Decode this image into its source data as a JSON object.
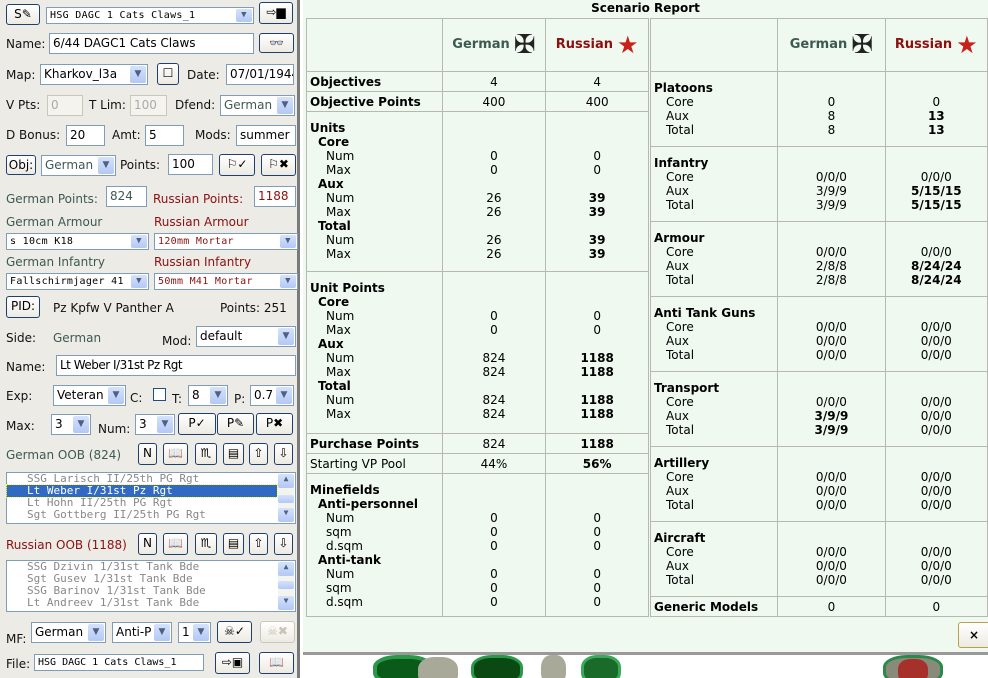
{
  "left": {
    "scenario_select": "HSG DAGC 1 Cats Claws_1",
    "name_label": "Name:",
    "name_value": "6/44 DAGC1 Cats Claws",
    "map_label": "Map:",
    "map_value": "Kharkov_l3a",
    "date_label": "Date:",
    "date_value": "07/01/1944",
    "vpts_label": "V Pts:",
    "vpts_value": "0",
    "tlim_label": "T Lim:",
    "tlim_value": "100",
    "dfend_label": "Dfend:",
    "dfend_value": "German",
    "dbonus_label": "D Bonus:",
    "dbonus_value": "20",
    "amt_label": "Amt:",
    "amt_value": "5",
    "mods_label": "Mods:",
    "mods_value": "summer",
    "obj_button": "Obj:",
    "obj_side": "German",
    "points_label": "Points:",
    "points_value": "100",
    "german_points_label": "German Points:",
    "german_points": "824",
    "russian_points_label": "Russian Points:",
    "russian_points": "1188",
    "german_armour_label": "German Armour",
    "german_armour": "s 10cm K18",
    "russian_armour_label": "Russian Armour",
    "russian_armour": "120mm Mortar",
    "german_infantry_label": "German Infantry",
    "german_infantry": "Fallschirmjager 41",
    "russian_infantry_label": "Russian Infantry",
    "russian_infantry": "50mm M41 Mortar",
    "pid_button": "PID:",
    "unit_type": "Pz Kpfw V Panther A",
    "unit_points": "Points: 251",
    "side_label": "Side:",
    "side_value": "German",
    "mod_label": "Mod:",
    "mod_value": "default",
    "unit_name_label": "Name:",
    "unit_name": "Lt Weber I/31st Pz Rgt",
    "exp_label": "Exp:",
    "exp_value": "Veteran",
    "c_label": "C:",
    "t_label": "T:",
    "t_value": "8",
    "p_label": "P:",
    "p_value": "0.7",
    "max_label": "Max:",
    "max_value": "3",
    "num_label": "Num:",
    "num_value": "3",
    "german_oob_label": "German OOB (824)",
    "russian_oob_label": "Russian OOB (1188)",
    "n_button": "N",
    "german_oob": [
      "SSG Larisch II/25th PG Rgt",
      "Lt Weber I/31st Pz Rgt",
      "Lt Hohn II/25th PG Rgt",
      "Sgt Gottberg II/25th PG Rgt"
    ],
    "german_oob_selected": 1,
    "russian_oob": [
      "SSG Dzivin 1/31st Tank Bde",
      "Sgt Gusev 1/31st Tank Bde",
      "SSG Barinov 1/31st Tank Bde",
      "Lt Andreev 1/31st Tank Bde"
    ],
    "mf_label": "MF:",
    "mf_side": "German",
    "mf_type": "Anti-P",
    "mf_count": "1",
    "file_label": "File:",
    "file_value": "HSG DAGC 1 Cats Claws_1"
  },
  "report": {
    "title": "Scenario Report",
    "german": "German",
    "russian": "Russian",
    "left_sections": [
      {
        "lines": [
          {
            "t": "Objectives",
            "lv": 0,
            "g": "4",
            "r": "4"
          }
        ]
      },
      {
        "lines": [
          {
            "t": "Objective Points",
            "lv": 0,
            "g": "400",
            "r": "400"
          }
        ]
      },
      {
        "lines": [
          {
            "t": "Units",
            "lv": 0,
            "g": "",
            "r": ""
          },
          {
            "t": "Core",
            "lv": 1,
            "g": "",
            "r": ""
          },
          {
            "t": "Num",
            "lv": 2,
            "g": "0",
            "r": "0"
          },
          {
            "t": "Max",
            "lv": 2,
            "g": "0",
            "r": "0"
          },
          {
            "t": "Aux",
            "lv": 1,
            "g": "",
            "r": ""
          },
          {
            "t": "Num",
            "lv": 2,
            "g": "26",
            "r": "39",
            "rb": true
          },
          {
            "t": "Max",
            "lv": 2,
            "g": "26",
            "r": "39",
            "rb": true
          },
          {
            "t": "Total",
            "lv": 1,
            "g": "",
            "r": ""
          },
          {
            "t": "Num",
            "lv": 2,
            "g": "26",
            "r": "39",
            "rb": true
          },
          {
            "t": "Max",
            "lv": 2,
            "g": "26",
            "r": "39",
            "rb": true
          }
        ]
      },
      {
        "lines": [
          {
            "t": "Unit Points",
            "lv": 0,
            "g": "",
            "r": ""
          },
          {
            "t": "Core",
            "lv": 1,
            "g": "",
            "r": ""
          },
          {
            "t": "Num",
            "lv": 2,
            "g": "0",
            "r": "0"
          },
          {
            "t": "Max",
            "lv": 2,
            "g": "0",
            "r": "0"
          },
          {
            "t": "Aux",
            "lv": 1,
            "g": "",
            "r": ""
          },
          {
            "t": "Num",
            "lv": 2,
            "g": "824",
            "r": "1188",
            "rb": true
          },
          {
            "t": "Max",
            "lv": 2,
            "g": "824",
            "r": "1188",
            "rb": true
          },
          {
            "t": "Total",
            "lv": 1,
            "g": "",
            "r": ""
          },
          {
            "t": "Num",
            "lv": 2,
            "g": "824",
            "r": "1188",
            "rb": true
          },
          {
            "t": "Max",
            "lv": 2,
            "g": "824",
            "r": "1188",
            "rb": true
          }
        ]
      },
      {
        "lines": [
          {
            "t": "Purchase Points",
            "lv": 0,
            "g": "824",
            "r": "1188",
            "rb": true
          }
        ]
      },
      {
        "lines": [
          {
            "t": "Starting VP Pool",
            "lv": 3,
            "g": "44%",
            "r": "56%",
            "rb": true
          }
        ]
      },
      {
        "lines": [
          {
            "t": "Minefields",
            "lv": 0,
            "g": "",
            "r": ""
          },
          {
            "t": "Anti-personnel",
            "lv": 1,
            "g": "",
            "r": ""
          },
          {
            "t": "Num",
            "lv": 2,
            "g": "0",
            "r": "0"
          },
          {
            "t": "sqm",
            "lv": 2,
            "g": "0",
            "r": "0"
          },
          {
            "t": "d.sqm",
            "lv": 2,
            "g": "0",
            "r": "0"
          },
          {
            "t": "Anti-tank",
            "lv": 1,
            "g": "",
            "r": ""
          },
          {
            "t": "Num",
            "lv": 2,
            "g": "0",
            "r": "0"
          },
          {
            "t": "sqm",
            "lv": 2,
            "g": "0",
            "r": "0"
          },
          {
            "t": "d.sqm",
            "lv": 2,
            "g": "0",
            "r": "0"
          }
        ]
      }
    ],
    "right_sections": [
      {
        "lines": [
          {
            "t": "Platoons",
            "lv": 0,
            "g": "",
            "r": ""
          },
          {
            "t": "Core",
            "lv": 2,
            "g": "0",
            "r": "0"
          },
          {
            "t": "Aux",
            "lv": 2,
            "g": "8",
            "r": "13",
            "rb": true
          },
          {
            "t": "Total",
            "lv": 2,
            "g": "8",
            "r": "13",
            "rb": true
          }
        ]
      },
      {
        "lines": [
          {
            "t": "Infantry",
            "lv": 0,
            "g": "",
            "r": ""
          },
          {
            "t": "Core",
            "lv": 2,
            "g": "0/0/0",
            "r": "0/0/0"
          },
          {
            "t": "Aux",
            "lv": 2,
            "g": "3/9/9",
            "r": "5/15/15",
            "rb": true
          },
          {
            "t": "Total",
            "lv": 2,
            "g": "3/9/9",
            "r": "5/15/15",
            "rb": true
          }
        ]
      },
      {
        "lines": [
          {
            "t": "Armour",
            "lv": 0,
            "g": "",
            "r": ""
          },
          {
            "t": "Core",
            "lv": 2,
            "g": "0/0/0",
            "r": "0/0/0"
          },
          {
            "t": "Aux",
            "lv": 2,
            "g": "2/8/8",
            "r": "8/24/24",
            "rb": true
          },
          {
            "t": "Total",
            "lv": 2,
            "g": "2/8/8",
            "r": "8/24/24",
            "rb": true
          }
        ]
      },
      {
        "lines": [
          {
            "t": "Anti Tank Guns",
            "lv": 0,
            "g": "",
            "r": ""
          },
          {
            "t": "Core",
            "lv": 2,
            "g": "0/0/0",
            "r": "0/0/0"
          },
          {
            "t": "Aux",
            "lv": 2,
            "g": "0/0/0",
            "r": "0/0/0"
          },
          {
            "t": "Total",
            "lv": 2,
            "g": "0/0/0",
            "r": "0/0/0"
          }
        ]
      },
      {
        "lines": [
          {
            "t": "Transport",
            "lv": 0,
            "g": "",
            "r": ""
          },
          {
            "t": "Core",
            "lv": 2,
            "g": "0/0/0",
            "r": "0/0/0"
          },
          {
            "t": "Aux",
            "lv": 2,
            "g": "3/9/9",
            "r": "0/0/0",
            "gb": true
          },
          {
            "t": "Total",
            "lv": 2,
            "g": "3/9/9",
            "r": "0/0/0",
            "gb": true
          }
        ]
      },
      {
        "lines": [
          {
            "t": "Artillery",
            "lv": 0,
            "g": "",
            "r": ""
          },
          {
            "t": "Core",
            "lv": 2,
            "g": "0/0/0",
            "r": "0/0/0"
          },
          {
            "t": "Aux",
            "lv": 2,
            "g": "0/0/0",
            "r": "0/0/0"
          },
          {
            "t": "Total",
            "lv": 2,
            "g": "0/0/0",
            "r": "0/0/0"
          }
        ]
      },
      {
        "lines": [
          {
            "t": "Aircraft",
            "lv": 0,
            "g": "",
            "r": ""
          },
          {
            "t": "Core",
            "lv": 2,
            "g": "0/0/0",
            "r": "0/0/0"
          },
          {
            "t": "Aux",
            "lv": 2,
            "g": "0/0/0",
            "r": "0/0/0"
          },
          {
            "t": "Total",
            "lv": 2,
            "g": "0/0/0",
            "r": "0/0/0"
          }
        ]
      },
      {
        "lines": [
          {
            "t": "Generic Models",
            "lv": 0,
            "g": "0",
            "r": "0"
          }
        ]
      }
    ],
    "close_icon": "×"
  }
}
